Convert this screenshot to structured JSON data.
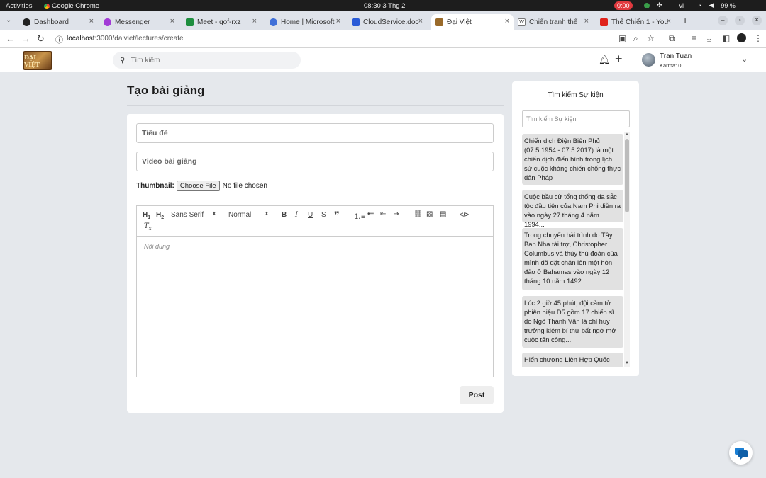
{
  "system": {
    "activities": "Activities",
    "app_name": "Google Chrome",
    "clock": "08:30  3 Thg 2",
    "recording": "0:00",
    "lang": "vi",
    "battery": "99 %"
  },
  "tabs": [
    {
      "label": "Dashboard",
      "color": "#222222"
    },
    {
      "label": "Messenger",
      "color": "#a23bd6"
    },
    {
      "label": "Meet - qof-rxz",
      "color": "#1e8e3e"
    },
    {
      "label": "Home | Microsoft",
      "color": "#3f6fd8"
    },
    {
      "label": "CloudService.doc",
      "color": "#2a5bd7"
    },
    {
      "label": "Đại Việt",
      "color": "#9a6a2a"
    },
    {
      "label": "Chiến tranh thế",
      "color": "#444444"
    },
    {
      "label": "Thế Chiến 1 - You",
      "color": "#e0231b"
    }
  ],
  "address": {
    "host": "localhost",
    "path": ":3000/daiviet/lectures/create"
  },
  "nav": {
    "logo_text": "ĐẠI VIỆT",
    "search_placeholder": "Tìm kiếm",
    "user_name": "Tran Tuan",
    "karma": "Karma: 0"
  },
  "form": {
    "page_title": "Tạo bài giảng",
    "title_placeholder": "Tiêu đề",
    "video_placeholder": "Video bài giảng",
    "thumbnail_label": "Thumbnail:",
    "choose_file": "Choose File",
    "no_file": "No file chosen",
    "font_select": "Sans Serif",
    "size_select": "Normal",
    "content_placeholder": "Nội dung",
    "post_button": "Post"
  },
  "sidebar": {
    "title": "Tìm kiếm Sự kiện",
    "search_placeholder": "Tìm kiếm Sự kiện",
    "events": [
      "Chiến dịch Điện Biên Phủ (07.5.1954 - 07.5.2017) là một chiến dịch điển hình trong lịch sử cuộc kháng chiến chống thực dân Pháp",
      "Cuộc bầu cử tổng thống đa sắc tộc đầu tiên của Nam Phi diễn ra vào ngày 27 tháng 4 năm 1994...",
      "Trong chuyến hải trình do Tây Ban Nha tài trợ, Christopher Columbus và thủy thủ đoàn của mình đã đặt chân lên một hòn đảo ở Bahamas vào ngày 12 tháng 10 năm 1492...",
      "Lúc 2 giờ 45 phút, đội cảm tử phiên hiệu D5 gồm 17 chiến sĩ do Ngô Thành Vân là chỉ huy trưởng kiêm bí thư bất ngờ mở cuộc tấn công...",
      "Hiến chương Liên Hợp Quốc"
    ]
  }
}
